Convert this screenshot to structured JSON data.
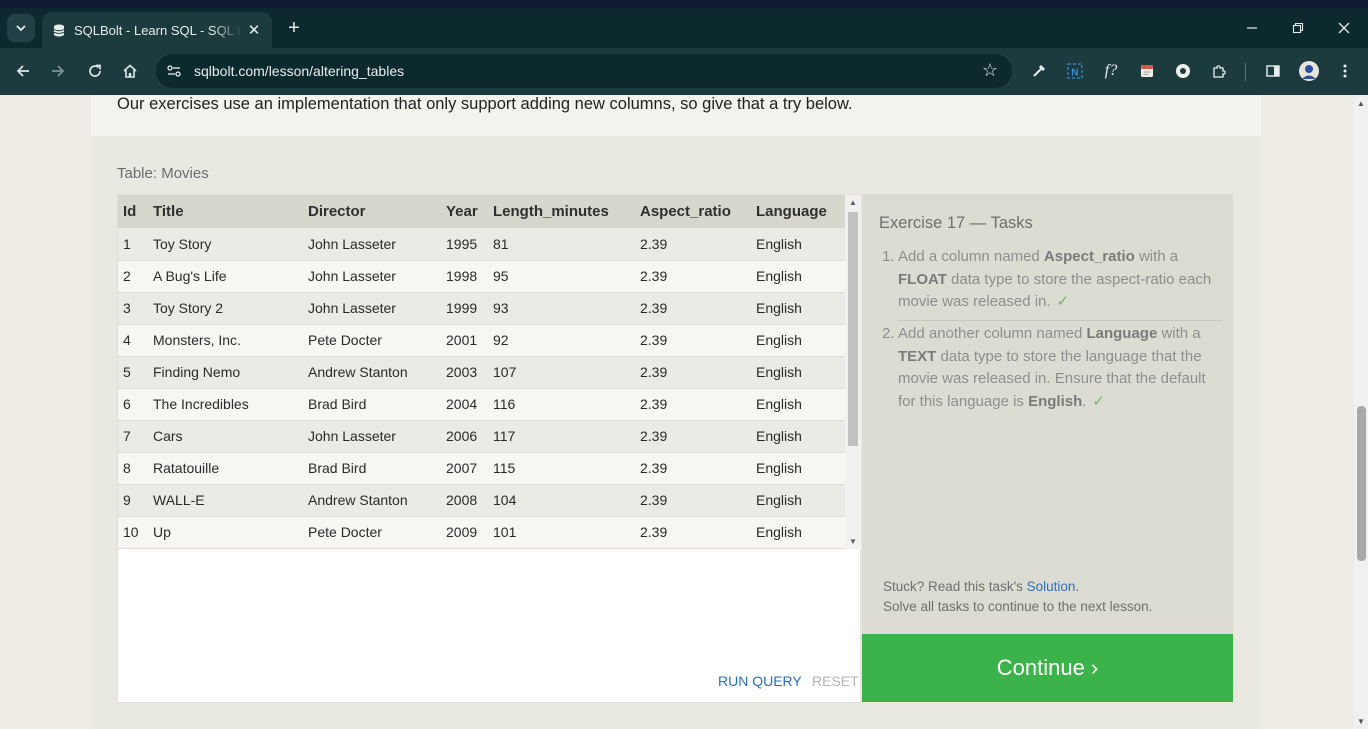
{
  "browser": {
    "tab_title": "SQLBolt - Learn SQL - SQL Lesson",
    "tab_close": "✕",
    "new_tab": "+",
    "url": "sqlbolt.com/lesson/altering_tables",
    "extensions": [
      "eyedropper-icon",
      "notion-icon",
      "formula-icon",
      "note-icon",
      "profile-circle-icon",
      "puzzle-icon"
    ]
  },
  "lesson": {
    "intro_line": "Our exercises use an implementation that only support adding new columns, so give that a try below."
  },
  "table": {
    "caption": "Table: Movies",
    "columns": [
      "Id",
      "Title",
      "Director",
      "Year",
      "Length_minutes",
      "Aspect_ratio",
      "Language"
    ],
    "rows": [
      [
        "1",
        "Toy Story",
        "John Lasseter",
        "1995",
        "81",
        "2.39",
        "English"
      ],
      [
        "2",
        "A Bug's Life",
        "John Lasseter",
        "1998",
        "95",
        "2.39",
        "English"
      ],
      [
        "3",
        "Toy Story 2",
        "John Lasseter",
        "1999",
        "93",
        "2.39",
        "English"
      ],
      [
        "4",
        "Monsters, Inc.",
        "Pete Docter",
        "2001",
        "92",
        "2.39",
        "English"
      ],
      [
        "5",
        "Finding Nemo",
        "Andrew Stanton",
        "2003",
        "107",
        "2.39",
        "English"
      ],
      [
        "6",
        "The Incredibles",
        "Brad Bird",
        "2004",
        "116",
        "2.39",
        "English"
      ],
      [
        "7",
        "Cars",
        "John Lasseter",
        "2006",
        "117",
        "2.39",
        "English"
      ],
      [
        "8",
        "Ratatouille",
        "Brad Bird",
        "2007",
        "115",
        "2.39",
        "English"
      ],
      [
        "9",
        "WALL-E",
        "Andrew Stanton",
        "2008",
        "104",
        "2.39",
        "English"
      ],
      [
        "10",
        "Up",
        "Pete Docter",
        "2009",
        "101",
        "2.39",
        "English"
      ]
    ]
  },
  "actions": {
    "run_query": "RUN QUERY",
    "reset": "RESET"
  },
  "tasks": {
    "title": "Exercise 17 — Tasks",
    "items": [
      {
        "number": "1.",
        "parts": [
          "Add a column named ",
          "Aspect_ratio",
          " with a ",
          "FLOAT",
          " data type to store the aspect-ratio each movie was released in."
        ],
        "check": "✓"
      },
      {
        "number": "2.",
        "parts": [
          "Add another column named ",
          "Language",
          " with a ",
          "TEXT",
          " data type to store the language that the movie was released in. Ensure that the default for this language is ",
          "English",
          "."
        ],
        "check": "✓"
      }
    ],
    "stuck_prefix": "Stuck? Read this task's ",
    "solution_link": "Solution",
    "stuck_suffix": ".",
    "solve_all": "Solve all tasks to continue to the next lesson."
  },
  "continue_label": "Continue ›",
  "colors": {
    "continue_green": "#3bb24a",
    "link_blue": "#2b6fb8",
    "check_green": "#6fb66f"
  }
}
